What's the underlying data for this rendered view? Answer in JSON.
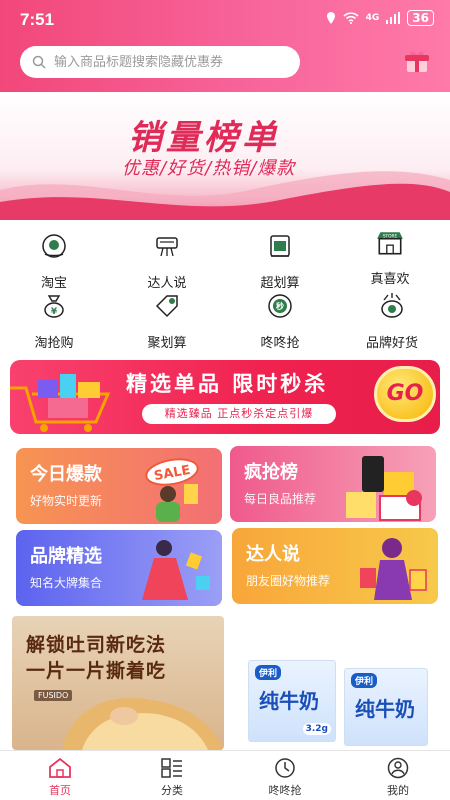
{
  "status": {
    "time": "7:51",
    "network": "4G",
    "battery": "36"
  },
  "search": {
    "placeholder": "输入商品标题搜索隐藏优惠券"
  },
  "banner": {
    "title": "销量榜单",
    "subtitle": "优惠/好货/热销/爆款"
  },
  "categories": [
    {
      "label": "淘宝",
      "icon": "taobao-icon"
    },
    {
      "label": "达人说",
      "icon": "camera-icon"
    },
    {
      "label": "超划算",
      "icon": "bargain-icon"
    },
    {
      "label": "真喜欢",
      "icon": "store-icon"
    },
    {
      "label": "淘抢购",
      "icon": "moneybag-icon"
    },
    {
      "label": "聚划算",
      "icon": "tag-icon"
    },
    {
      "label": "咚咚抢",
      "icon": "grab-icon"
    },
    {
      "label": "品牌好货",
      "icon": "brand-icon"
    }
  ],
  "promo": {
    "title": "精选单品 限时秒杀",
    "tagline": "精选臻品 正点秒杀定点引爆",
    "go": "GO"
  },
  "cards": [
    {
      "title": "今日爆款",
      "subtitle": "好物实时更新",
      "art_text": "SALE",
      "color": "#f7845c"
    },
    {
      "title": "疯抢榜",
      "subtitle": "每日良品推荐",
      "color": "#f2638c"
    },
    {
      "title": "品牌精选",
      "subtitle": "知名大牌集合",
      "color": "#6b6ff0"
    },
    {
      "title": "达人说",
      "subtitle": "朋友圈好物推荐",
      "color": "#f8a63a"
    }
  ],
  "ads": {
    "toast": {
      "line1": "解锁吐司新吃法",
      "line2": "一片一片撕着吃",
      "brand": "FUSIDO"
    },
    "milk": {
      "brand": "伊利",
      "name": "纯牛奶",
      "protein": "3.2g"
    }
  },
  "tabbar": [
    {
      "label": "首页",
      "active": true
    },
    {
      "label": "分类",
      "active": false
    },
    {
      "label": "咚咚抢",
      "active": false
    },
    {
      "label": "我的",
      "active": false
    }
  ],
  "colors": {
    "accent": "#e8365e",
    "header": "#f2477a"
  }
}
